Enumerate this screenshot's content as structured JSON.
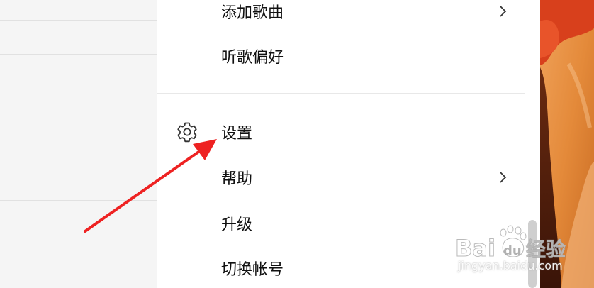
{
  "menu": {
    "items": [
      {
        "label": "添加歌曲",
        "has_submenu": true
      },
      {
        "label": "听歌偏好",
        "has_submenu": false
      },
      {
        "label": "设置",
        "icon": "gear-icon",
        "has_submenu": false
      },
      {
        "label": "帮助",
        "has_submenu": true
      },
      {
        "label": "升级",
        "has_submenu": false
      },
      {
        "label": "切换帐号",
        "has_submenu": false
      }
    ]
  },
  "annotation": {
    "arrow_color": "#ee2222"
  },
  "watermark": {
    "logo": "Baidu经验",
    "url": "jingyan.baidu.com"
  }
}
